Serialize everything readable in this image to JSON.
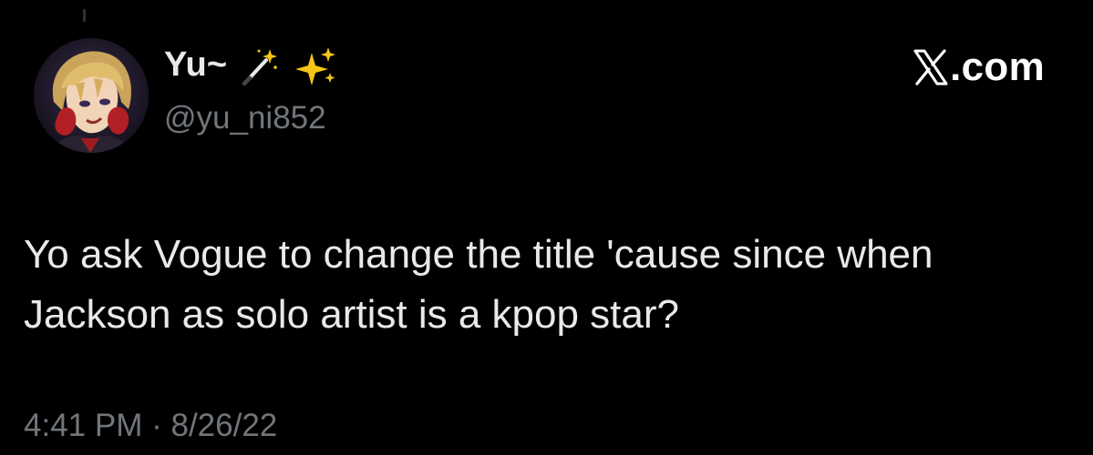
{
  "tweet": {
    "author": {
      "display_name": "Yu~",
      "name_emoji": [
        "magic-wand-icon",
        "sparkles-icon"
      ],
      "handle": "@yu_ni852",
      "avatar": "anime-character-avatar"
    },
    "brand": {
      "logo": "x-logo-icon",
      "text": ".com"
    },
    "text": "Yo ask Vogue to change the title 'cause since when\nJackson as solo artist is a kpop star?",
    "time": "4:41 PM",
    "separator": "·",
    "date": "8/26/22"
  },
  "colors": {
    "background": "#000000",
    "primary_text": "#e7e9ea",
    "secondary_text": "#71767b",
    "sparkle": "#f5c518"
  }
}
